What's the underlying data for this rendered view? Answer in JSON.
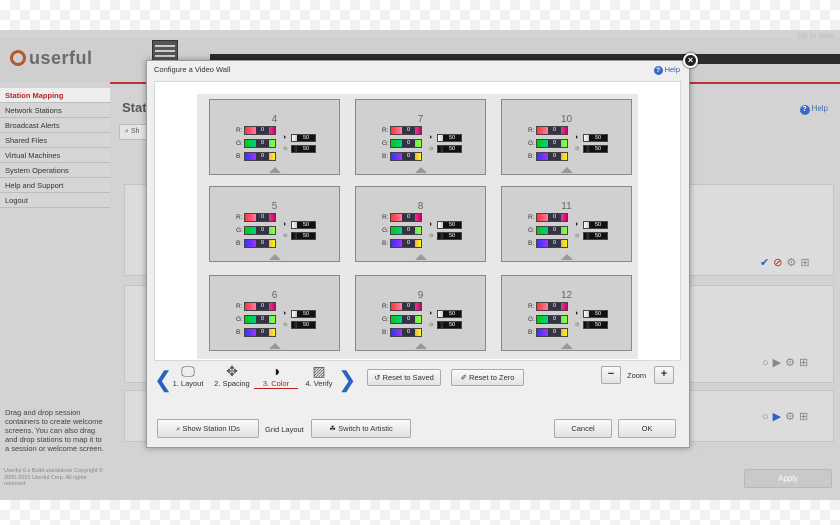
{
  "background": {
    "topright_text": "Up to date",
    "logo_text": "userful",
    "main_title": "Stati",
    "help_label": "Help",
    "search_label": "Sh",
    "sidebar": {
      "items": [
        {
          "label": "Station Mapping",
          "active": true
        },
        {
          "label": "Network Stations"
        },
        {
          "label": "Broadcast Alerts"
        },
        {
          "label": "Shared Files"
        },
        {
          "label": "Virtual Machines"
        },
        {
          "label": "System Operations"
        },
        {
          "label": "Help and Support"
        },
        {
          "label": "Logout"
        }
      ]
    },
    "sidebar_help": "Drag and drop session containers to create welcome screens. You can also drag and drop stations to map it to a session or welcome screen.",
    "footer": "Userful 6.x Build standalone Copyright © 2005-2015 Userful Corp. All rights reserved",
    "apply_label": "Apply"
  },
  "dialog": {
    "title": "Configure a Video Wall",
    "help_label": "Help",
    "close_icon": "×",
    "screens": [
      {
        "id": "4",
        "r": "0",
        "g": "0",
        "b": "0",
        "brightness": "50",
        "contrast": "50"
      },
      {
        "id": "7",
        "r": "0",
        "g": "0",
        "b": "0",
        "brightness": "50",
        "contrast": "50"
      },
      {
        "id": "10",
        "r": "0",
        "g": "0",
        "b": "0",
        "brightness": "50",
        "contrast": "50"
      },
      {
        "id": "5",
        "r": "0",
        "g": "0",
        "b": "0",
        "brightness": "50",
        "contrast": "50"
      },
      {
        "id": "8",
        "r": "0",
        "g": "0",
        "b": "0",
        "brightness": "50",
        "contrast": "50"
      },
      {
        "id": "11",
        "r": "0",
        "g": "0",
        "b": "0",
        "brightness": "50",
        "contrast": "50"
      },
      {
        "id": "6",
        "r": "0",
        "g": "0",
        "b": "0",
        "brightness": "50",
        "contrast": "50"
      },
      {
        "id": "9",
        "r": "0",
        "g": "0",
        "b": "0",
        "brightness": "50",
        "contrast": "50"
      },
      {
        "id": "12",
        "r": "0",
        "g": "0",
        "b": "0",
        "brightness": "50",
        "contrast": "50"
      }
    ],
    "rgb_labels": {
      "r": "R:",
      "g": "G:",
      "b": "B:"
    },
    "steps": [
      {
        "label": "1. Layout",
        "icon": "monitor-icon"
      },
      {
        "label": "2. Spacing",
        "icon": "move-icon"
      },
      {
        "label": "3. Color",
        "icon": "contrast-icon",
        "active": true
      },
      {
        "label": "4. Verify",
        "icon": "image-icon"
      }
    ],
    "reset_saved_label": "Reset to Saved",
    "reset_zero_label": "Reset to Zero",
    "zoom_minus": "−",
    "zoom_label": "Zoom",
    "zoom_plus": "+",
    "show_station_ids_label": "Show Station IDs",
    "grid_layout_label": "Grid Layout",
    "switch_artistic_label": "Switch to Artistic",
    "cancel_label": "Cancel",
    "ok_label": "OK"
  }
}
